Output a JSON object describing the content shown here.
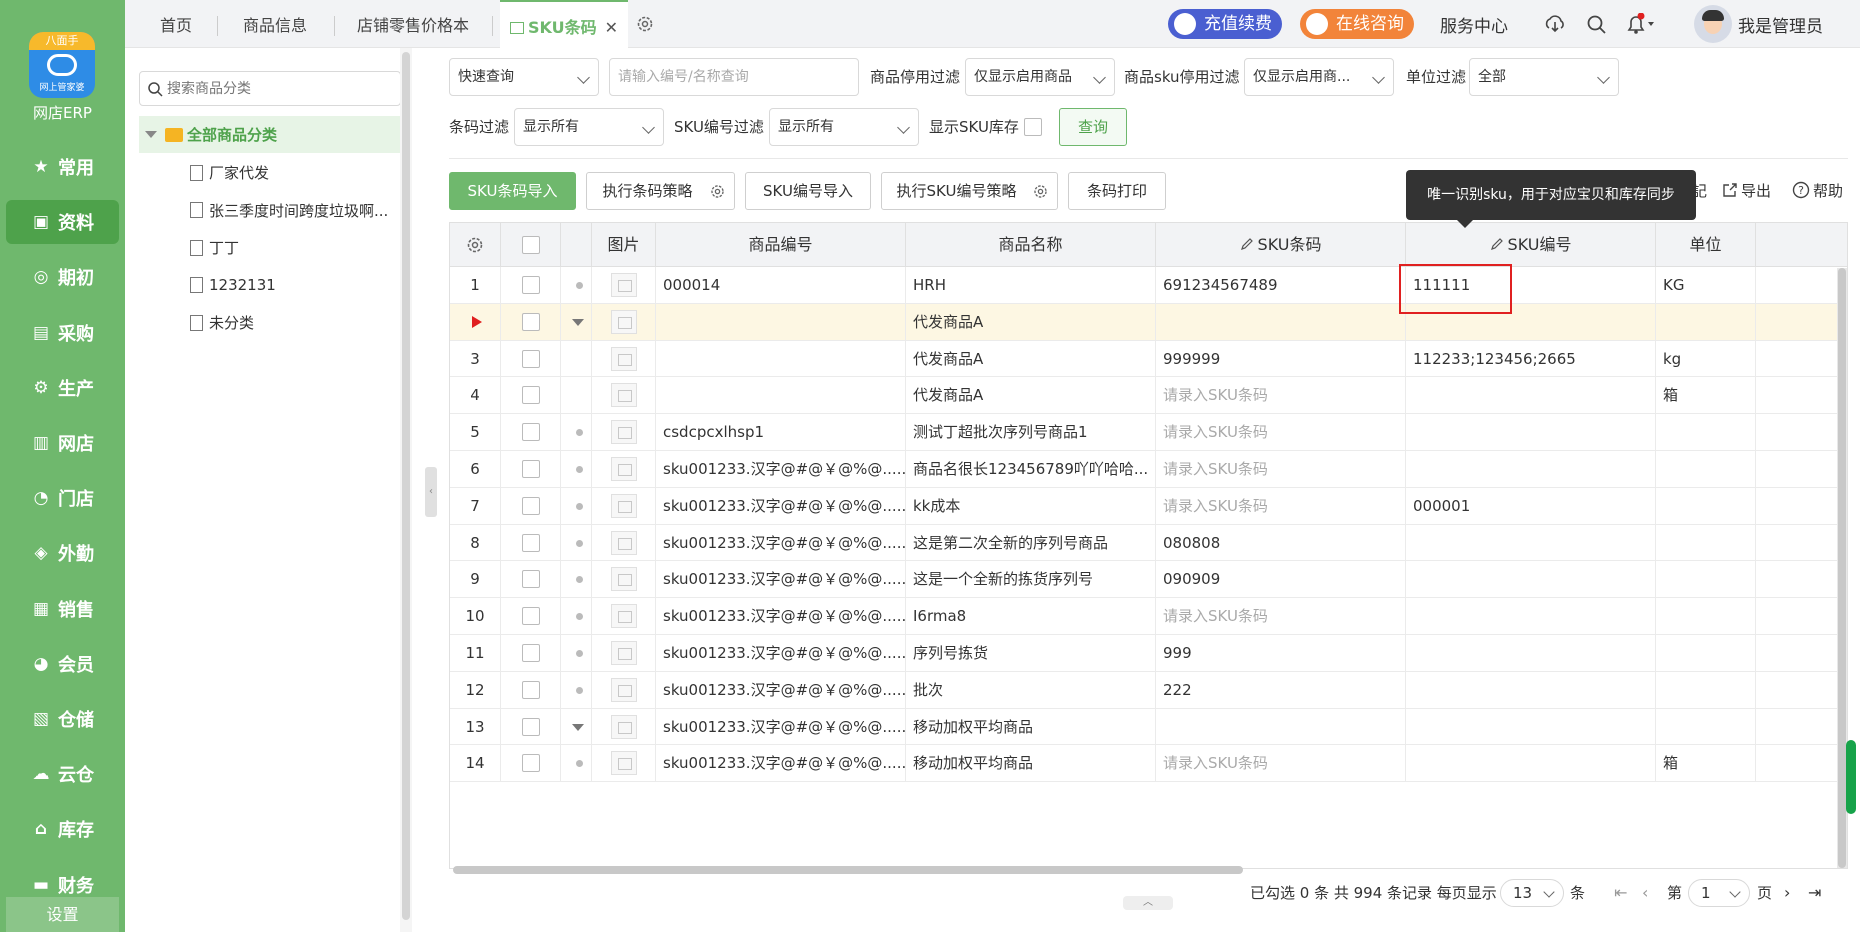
{
  "app": {
    "logo_top": "八面手",
    "logo_sub": "网上管家婆",
    "name": "网店ERP"
  },
  "nav": {
    "items": [
      {
        "label": "常用",
        "icon": "star-icon"
      },
      {
        "label": "资料",
        "icon": "id-card-icon"
      },
      {
        "label": "期初",
        "icon": "target-icon"
      },
      {
        "label": "采购",
        "icon": "purchase-icon"
      },
      {
        "label": "生产",
        "icon": "production-icon"
      },
      {
        "label": "网店",
        "icon": "store-icon"
      },
      {
        "label": "门店",
        "icon": "pie-icon"
      },
      {
        "label": "外勤",
        "icon": "compass-icon"
      },
      {
        "label": "销售",
        "icon": "chart-icon"
      },
      {
        "label": "会员",
        "icon": "member-icon"
      },
      {
        "label": "仓储",
        "icon": "warehouse-icon"
      },
      {
        "label": "云仓",
        "icon": "cloud-warehouse-icon"
      },
      {
        "label": "库存",
        "icon": "home-icon"
      },
      {
        "label": "财务",
        "icon": "wallet-icon"
      }
    ],
    "active_index": 1,
    "settings_label": "设置"
  },
  "topbar": {
    "tabs": [
      "首页",
      "商品信息",
      "店铺零售价格本"
    ],
    "active_tab": "SKU条码",
    "close_glyph": "✕",
    "recharge_label": "充值续费",
    "consult_label": "在线咨询",
    "service_label": "服务中心",
    "username": "我是管理员"
  },
  "category": {
    "search_placeholder": "搜索商品分类",
    "root": "全部商品分类",
    "items": [
      "厂家代发",
      "张三季度时间跨度垃圾啊...",
      "丁丁",
      "1232131",
      "未分类"
    ]
  },
  "filters": {
    "quick_query": "快速查询",
    "code_placeholder": "请输入编号/名称查询",
    "stop_filter_label": "商品停用过滤",
    "stop_filter_value": "仅显示启用商品",
    "sku_stop_filter_label": "商品sku停用过滤",
    "sku_stop_filter_value": "仅显示启用商...",
    "unit_filter_label": "单位过滤",
    "unit_filter_value": "全部",
    "barcode_filter_label": "条码过滤",
    "barcode_filter_value": "显示所有",
    "sku_no_filter_label": "SKU编号过滤",
    "sku_no_filter_value": "显示所有",
    "show_stock_label": "显示SKU库存",
    "query_label": "查询"
  },
  "toolbar": {
    "import_barcode": "SKU条码导入",
    "exec_barcode_policy": "执行条码策略",
    "import_sku_no": "SKU编号导入",
    "exec_sku_policy": "执行SKU编号策略",
    "print_barcode": "条码打印",
    "partial_link": "記",
    "export_label": "导出",
    "help_label": "帮助"
  },
  "tooltip": "唯一识别sku，用于对应宝贝和库存同步",
  "table": {
    "headers": [
      "图片",
      "商品编号",
      "商品名称",
      "SKU条码",
      "SKU编号",
      "单位"
    ],
    "rows": [
      {
        "no": "1",
        "marker": "dot",
        "code": "000014",
        "name": "HRH",
        "barcode": "691234567489",
        "sku_no": "111111",
        "unit": "KG"
      },
      {
        "no": "",
        "marker": "caret",
        "code": "",
        "name": "代发商品A",
        "barcode": "",
        "sku_no": "",
        "unit": ""
      },
      {
        "no": "3",
        "marker": "",
        "code": "",
        "name": "代发商品A",
        "barcode": "999999",
        "sku_no": "112233;123456;2665",
        "unit": "kg"
      },
      {
        "no": "4",
        "marker": "",
        "code": "",
        "name": "代发商品A",
        "barcode": "请录入SKU条码",
        "sku_no": "",
        "unit": "箱"
      },
      {
        "no": "5",
        "marker": "dot",
        "code": "csdcpcxlhsp1",
        "name": "测试丁超批次序列号商品1",
        "barcode": "请录入SKU条码",
        "sku_no": "",
        "unit": ""
      },
      {
        "no": "6",
        "marker": "dot",
        "code": "sku001233.汉字@#@￥@%@......",
        "name": "商品名很长123456789吖吖哈哈...",
        "barcode": "请录入SKU条码",
        "sku_no": "",
        "unit": ""
      },
      {
        "no": "7",
        "marker": "dot",
        "code": "sku001233.汉字@#@￥@%@......",
        "name": "kk成本",
        "barcode": "请录入SKU条码",
        "sku_no": "000001",
        "unit": ""
      },
      {
        "no": "8",
        "marker": "dot",
        "code": "sku001233.汉字@#@￥@%@......",
        "name": "这是第二次全新的序列号商品",
        "barcode": "080808",
        "sku_no": "",
        "unit": ""
      },
      {
        "no": "9",
        "marker": "dot",
        "code": "sku001233.汉字@#@￥@%@......",
        "name": "这是一个全新的拣货序列号",
        "barcode": "090909",
        "sku_no": "",
        "unit": ""
      },
      {
        "no": "10",
        "marker": "dot",
        "code": "sku001233.汉字@#@￥@%@......",
        "name": "I6rma8",
        "barcode": "请录入SKU条码",
        "sku_no": "",
        "unit": ""
      },
      {
        "no": "11",
        "marker": "dot",
        "code": "sku001233.汉字@#@￥@%@......",
        "name": "序列号拣货",
        "barcode": "999",
        "sku_no": "",
        "unit": ""
      },
      {
        "no": "12",
        "marker": "dot",
        "code": "sku001233.汉字@#@￥@%@......",
        "name": "批次",
        "barcode": "222",
        "sku_no": "",
        "unit": ""
      },
      {
        "no": "13",
        "marker": "caret",
        "code": "sku001233.汉字@#@￥@%@......",
        "name": "移动加权平均商品",
        "barcode": "",
        "sku_no": "",
        "unit": ""
      },
      {
        "no": "14",
        "marker": "dot",
        "code": "sku001233.汉字@#@￥@%@......",
        "name": "移动加权平均商品",
        "barcode": "请录入SKU条码",
        "sku_no": "",
        "unit": "箱"
      }
    ]
  },
  "pager": {
    "summary": "已勾选 0 条  共 994 条记录  每页显示",
    "page_size": "13",
    "unit": "条",
    "page_prefix": "第",
    "current_page": "1",
    "page_suffix": "页"
  },
  "colors": {
    "brand_green": "#6fb86d",
    "recharge_blue": "#4a5fd1",
    "consult_orange": "#f2843a",
    "highlight_red": "#e02020"
  }
}
